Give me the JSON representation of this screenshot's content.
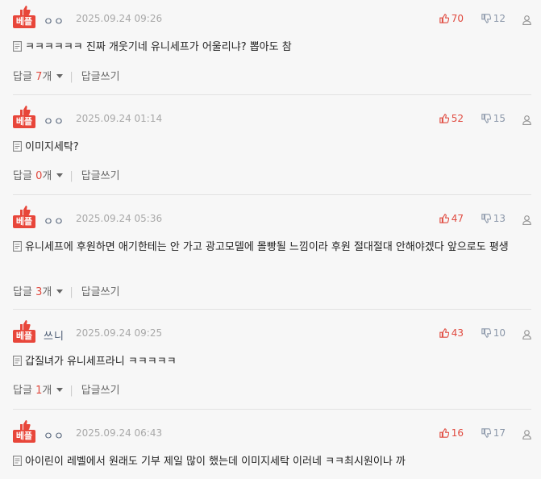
{
  "comments": [
    {
      "badge": "베플",
      "nick": "ㅇㅇ",
      "date": "2025.09.24 09:26",
      "up": "70",
      "down": "12",
      "text": "ㅋㅋㅋㅋㅋㅋ 진짜 개웃기네 유니세프가 어울리냐? 뽑아도 참",
      "reply_label": "답글",
      "reply_count": "7",
      "reply_unit": "개",
      "write_label": "답글쓰기"
    },
    {
      "badge": "베플",
      "nick": "ㅇㅇ",
      "date": "2025.09.24 01:14",
      "up": "52",
      "down": "15",
      "text": "이미지세탁?",
      "reply_label": "답글",
      "reply_count": "0",
      "reply_unit": "개",
      "write_label": "답글쓰기"
    },
    {
      "badge": "베플",
      "nick": "ㅇㅇ",
      "date": "2025.09.24 05:36",
      "up": "47",
      "down": "13",
      "text": "유니세프에 후원하면 애기한테는 안 가고 광고모델에 몰빵될 느낌이라 후원 절대절대 안해야겠다 앞으로도 평생",
      "reply_label": "답글",
      "reply_count": "3",
      "reply_unit": "개",
      "write_label": "답글쓰기"
    },
    {
      "badge": "베플",
      "nick": "쓰니",
      "date": "2025.09.24 09:25",
      "up": "43",
      "down": "10",
      "text": "갑질녀가 유니세프라니 ㅋㅋㅋㅋㅋ",
      "reply_label": "답글",
      "reply_count": "1",
      "reply_unit": "개",
      "write_label": "답글쓰기"
    },
    {
      "badge": "베플",
      "nick": "ㅇㅇ",
      "date": "2025.09.24 06:43",
      "up": "16",
      "down": "17",
      "text": "아이린이 레벨에서 원래도 기부 제일 많이 했는데 이미지세탁 이러네 ㅋㅋ최시원이나 까",
      "reply_label": "",
      "reply_count": "",
      "reply_unit": "",
      "write_label": ""
    }
  ],
  "colors": {
    "accent": "#e8463a",
    "up": "#e04a3f",
    "down": "#8c98aa",
    "date": "#a8a8a8"
  },
  "icons": {
    "badge": "thumbs-up-icon",
    "up": "thumbs-up-icon",
    "down": "thumbs-down-icon",
    "report": "user-icon",
    "memo": "memo-icon",
    "caret": "caret-down-icon"
  }
}
